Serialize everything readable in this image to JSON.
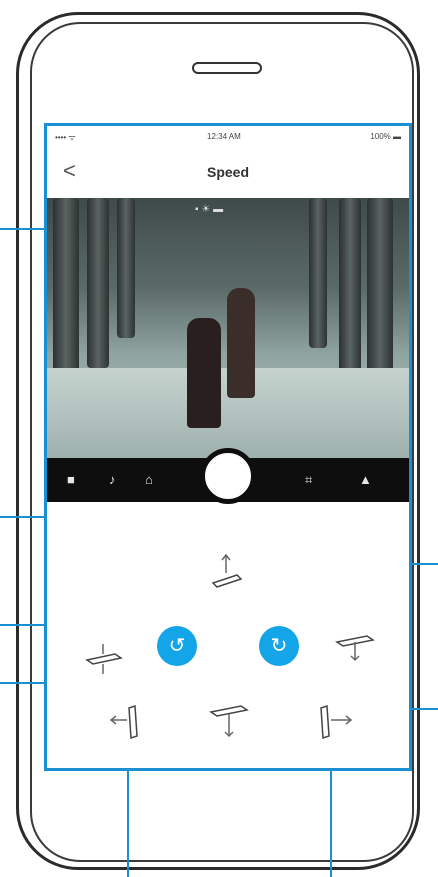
{
  "status_bar": {
    "carrier": "•••• ᯤ",
    "time": "12:34 AM",
    "battery": "100% ▬"
  },
  "nav": {
    "back_label": "<",
    "title": "Speed"
  },
  "camera": {
    "top_indicators": "▪ ☀ ▬"
  },
  "control_bar": {
    "icons": [
      "stop-square-icon",
      "music-note-icon",
      "camera-icon",
      "frame-icon",
      "ai-mode-icon"
    ],
    "glyphs": [
      "■",
      "♪",
      "⌂",
      "⌗",
      "▲"
    ]
  },
  "gimbal_controls": {
    "rotate_left_glyph": "↺",
    "rotate_right_glyph": "↻"
  },
  "colors": {
    "accent": "#14a4e8",
    "outline": "#1a8fd3",
    "control_bar": "#0e0e0e"
  }
}
